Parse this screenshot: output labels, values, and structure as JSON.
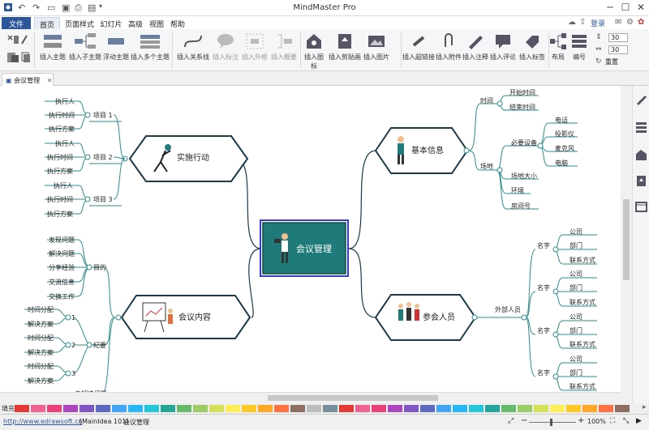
{
  "window": {
    "title": "MindMaster Pro",
    "login": "登录"
  },
  "menu": {
    "file": "文件",
    "items": [
      "首页",
      "页面样式",
      "幻灯片",
      "高级",
      "视图",
      "帮助"
    ]
  },
  "ribbon": {
    "buttons": [
      "插入主题",
      "插入子主题",
      "浮动主题",
      "插入多个主题",
      "插入关系线",
      "插入标注",
      "插入外框",
      "插入概要",
      "插入图标",
      "插入剪贴画",
      "插入图片",
      "插入超链接",
      "插入附件",
      "插入注释",
      "插入评论",
      "插入标签",
      "布局",
      "编号"
    ],
    "spin1": "30",
    "spin2": "30",
    "reset": "重置"
  },
  "tab": {
    "label": "会议管理",
    "close": "✕"
  },
  "mindmap": {
    "central": "会议管理",
    "topics": {
      "implement": "实施行动",
      "basic": "基本信息",
      "content": "会议内容",
      "attendees": "参会人员"
    },
    "implement_items": [
      {
        "label": "项目 1",
        "subs": [
          "执行人",
          "执行时间",
          "执行方案"
        ]
      },
      {
        "label": "项目 2",
        "subs": [
          "执行人",
          "执行时间",
          "执行方案"
        ]
      },
      {
        "label": "项目 3",
        "subs": [
          "执行人",
          "执行时间",
          "执行方案"
        ]
      }
    ],
    "basic_time": {
      "label": "时间",
      "subs": [
        "开始时间",
        "结束时间"
      ]
    },
    "basic_place": {
      "label": "场地",
      "equipment": "必要设备",
      "equip_subs": [
        "电话",
        "投影仪",
        "麦克风",
        "电脑"
      ],
      "others": [
        "场地大小",
        "环境",
        "房间号"
      ]
    },
    "content_goal": {
      "label": "目的",
      "subs": [
        "发现问题",
        "解决问题",
        "分享经验",
        "交流信息",
        "交换工作"
      ]
    },
    "content_minutes": {
      "label": "纪要",
      "items": [
        {
          "n": "1",
          "subs": [
            "时间分配",
            "解决方案"
          ]
        },
        {
          "n": "2",
          "subs": [
            "时间分配",
            "解决方案"
          ]
        },
        {
          "n": "3",
          "subs": [
            "时间分配",
            "解决方案"
          ]
        }
      ]
    },
    "content_unsolved": "未解决问题",
    "attendees_external": {
      "label": "外部人员",
      "groups": [
        {
          "label": "名字",
          "subs": [
            "公司",
            "部门",
            "联系方式"
          ]
        },
        {
          "label": "名字",
          "subs": [
            "公司",
            "部门",
            "联系方式"
          ]
        },
        {
          "label": "名字",
          "subs": [
            "公司",
            "部门",
            "联系方式"
          ]
        },
        {
          "label": "名字",
          "subs": [
            "公司",
            "部门",
            "联系方式"
          ]
        }
      ]
    }
  },
  "palette": {
    "fill_label": "填充"
  },
  "status": {
    "link": "http://www.edrawsoft.cn",
    "doc": "[MainIdea 101]",
    "title": "会议管理",
    "zoom": "100%"
  },
  "colors": {
    "accent": "#2b579a",
    "topic_border": "#1a3a4a",
    "branch": "#2e8b8b",
    "central_fill": "#1f7a7a",
    "central_border": "#3a3ad0"
  }
}
